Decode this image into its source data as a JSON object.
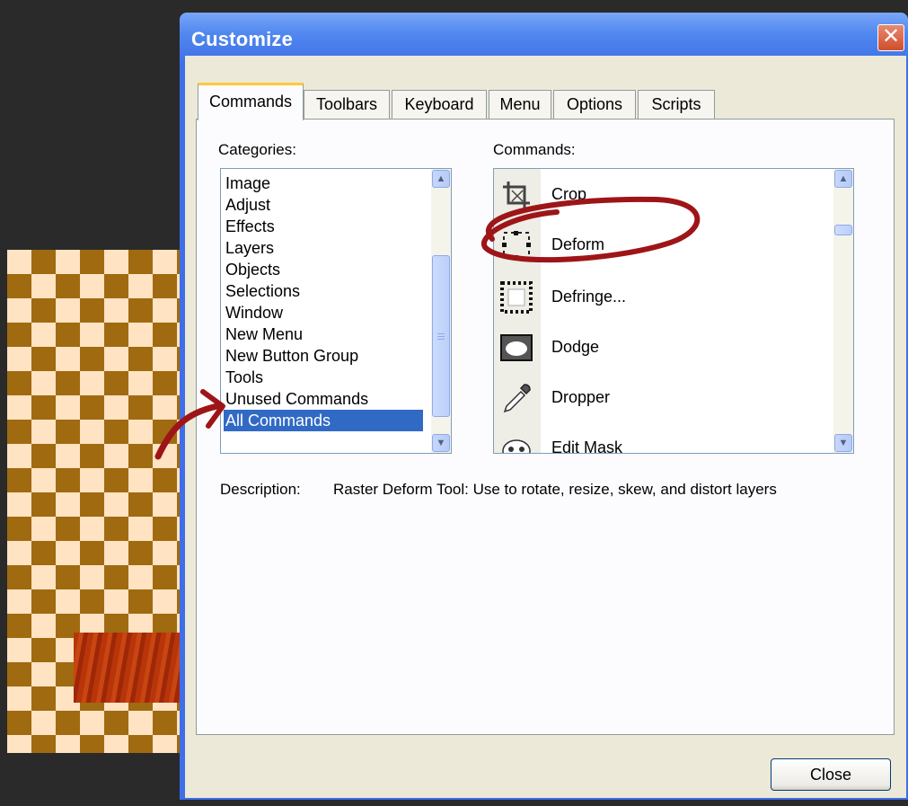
{
  "window": {
    "title": "Customize",
    "close_glyph": "✕",
    "colors": {
      "titlebar": "#3f6ee8",
      "client": "#ece9d8",
      "selection": "#316ac5",
      "annotation": "#9e1518"
    }
  },
  "tabs": [
    {
      "label": "Commands",
      "active": true
    },
    {
      "label": "Toolbars"
    },
    {
      "label": "Keyboard"
    },
    {
      "label": "Menu"
    },
    {
      "label": "Options"
    },
    {
      "label": "Scripts"
    }
  ],
  "categories": {
    "label": "Categories:",
    "items": [
      "Image",
      "Adjust",
      "Effects",
      "Layers",
      "Objects",
      "Selections",
      "Window",
      "New Menu",
      "New Button Group",
      "Tools",
      "Unused Commands",
      "All Commands"
    ],
    "selected": "All Commands"
  },
  "commands": {
    "label": "Commands:",
    "items": [
      {
        "label": "Crop",
        "icon": "crop-icon"
      },
      {
        "label": "Deform",
        "icon": "deform-icon"
      },
      {
        "label": "Defringe...",
        "icon": "defringe-icon"
      },
      {
        "label": "Dodge",
        "icon": "dodge-icon"
      },
      {
        "label": "Dropper",
        "icon": "dropper-icon"
      },
      {
        "label": "Edit Mask",
        "icon": "edit-mask-icon"
      }
    ]
  },
  "description": {
    "label": "Description:",
    "text": "Raster Deform Tool: Use to rotate, resize, skew, and distort layers"
  },
  "footer": {
    "close_label": "Close"
  }
}
